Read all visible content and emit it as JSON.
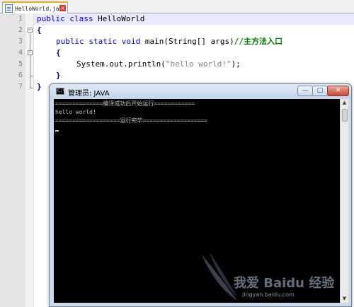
{
  "editor": {
    "tab": {
      "label": "HelloWorld.java",
      "close_glyph": "×"
    },
    "line_numbers": [
      "1",
      "2",
      "3",
      "4",
      "5",
      "6",
      "7"
    ],
    "lines": {
      "l1": {
        "kw1": "public",
        "kw2": "class",
        "name": "HelloWorld"
      },
      "l2": {
        "brace": "{"
      },
      "l3": {
        "kw1": "public",
        "kw2": "static",
        "kw3": "void",
        "sig": "main(String[] args)",
        "comment": "//主方法入口"
      },
      "l4": {
        "brace": "{"
      },
      "l5": {
        "pre": "System.out.println(",
        "str": "\"hello world!\"",
        "post": ");"
      },
      "l6": {
        "brace": "}"
      },
      "l7": {
        "brace": "}"
      }
    },
    "colors": {
      "keyword": "#0000ff",
      "comment": "#008000",
      "string": "#808080",
      "current_line": "#e8e8ff"
    }
  },
  "console": {
    "title": "管理员: JAVA",
    "icon": "cmd-icon",
    "icon_text": "C:\\",
    "buttons": {
      "minimize": "—",
      "maximize": "□",
      "close": "✕"
    },
    "output": [
      "==============编译成功后开始运行============",
      "hello world!",
      "===================运行完毕==================="
    ]
  },
  "watermark": {
    "text": "我爱 Baidu 经验",
    "url": "jingyan.baidu.com"
  }
}
